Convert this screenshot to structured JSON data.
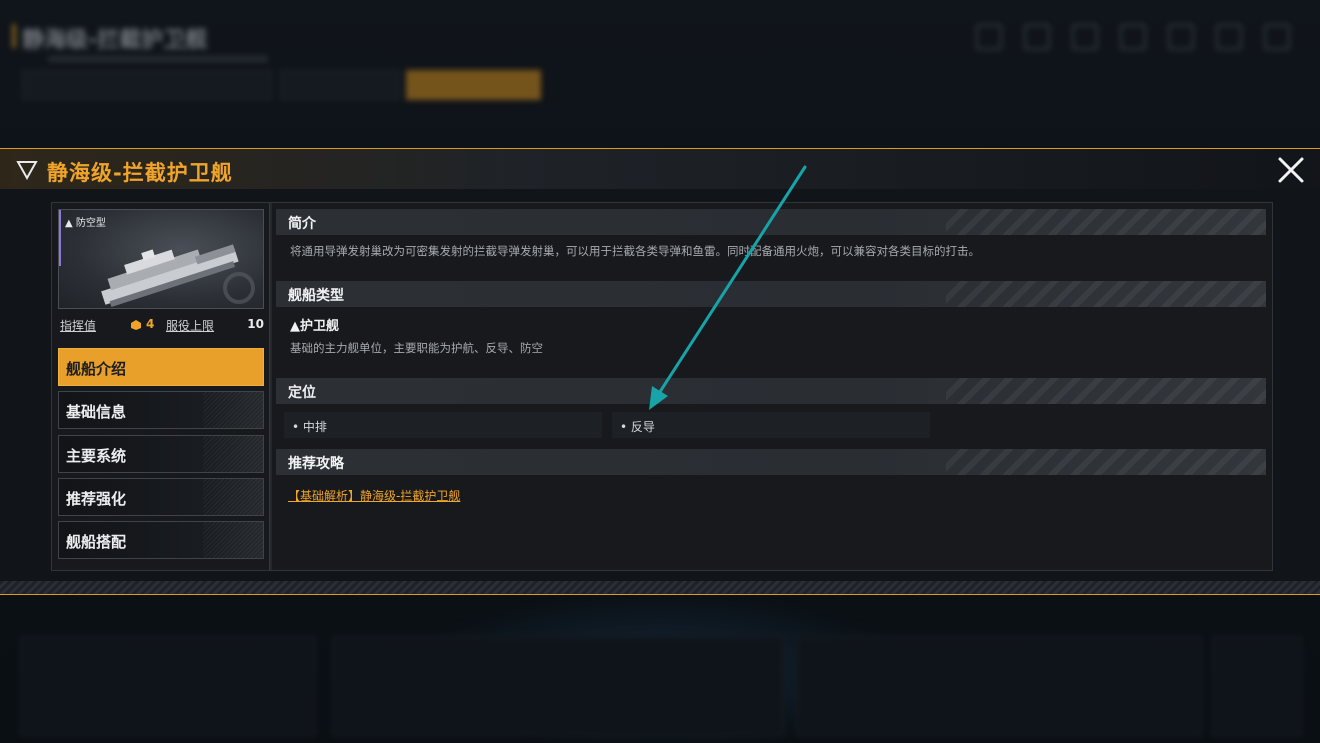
{
  "dialog": {
    "title": "静海级-拦截护卫舰",
    "accent": "#e8a02a"
  },
  "card": {
    "tag": "▲ 防空型",
    "command_label": "指挥值",
    "command_value": "4",
    "service_label": "服役上限",
    "service_value": "10"
  },
  "nav": {
    "items": [
      {
        "label": "舰船介绍",
        "active": true
      },
      {
        "label": "基础信息",
        "active": false
      },
      {
        "label": "主要系统",
        "active": false
      },
      {
        "label": "推荐强化",
        "active": false
      },
      {
        "label": "舰船搭配",
        "active": false
      }
    ]
  },
  "sections": {
    "intro": {
      "title": "简介",
      "text": "将通用导弹发射巢改为可密集发射的拦截导弹发射巢，可以用于拦截各类导弹和鱼雷。同时配备通用火炮，可以兼容对各类目标的打击。"
    },
    "ship_type": {
      "title": "舰船类型",
      "name": "▲护卫舰",
      "desc": "基础的主力舰单位，主要职能为护航、反导、防空"
    },
    "position": {
      "title": "定位",
      "items": [
        "• 中排",
        "• 反导"
      ]
    },
    "guide": {
      "title": "推荐攻略",
      "link": "【基础解析】静海级-拦截护卫舰"
    }
  },
  "icons": {
    "header": "triangle-down-icon",
    "close": "close-icon",
    "command": "command-point-icon"
  },
  "annotation_color": "#18a3a8"
}
